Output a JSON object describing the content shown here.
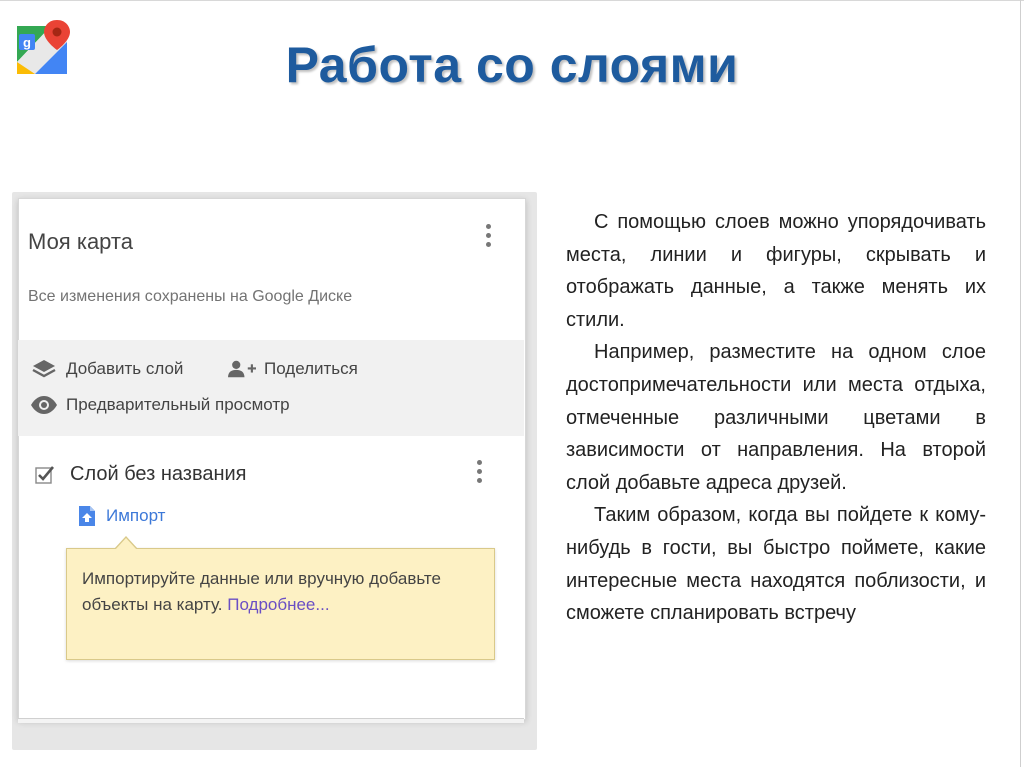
{
  "slide": {
    "title": "Работа со слоями"
  },
  "panel": {
    "map_title": "Моя карта",
    "saved_note": "Все изменения сохранены на Google Диске",
    "toolbar": {
      "add_layer": "Добавить слой",
      "share": "Поделиться",
      "preview": "Предварительный просмотр"
    },
    "layer": {
      "name": "Слой без названия",
      "checked": true,
      "import_label": "Импорт"
    },
    "tooltip": {
      "text": "Импортируйте данные или вручную добавьте объекты на карту.",
      "more_link": "Подробнее..."
    }
  },
  "body": {
    "paragraphs": [
      "С помощью слоев можно упорядочивать места, линии и фигуры, скрывать и отображать данные, а также менять их стили.",
      "Например, разместите на одном слое достопримечательности или места отдыха, отмеченные различными цветами в зависимости от направления. На второй слой добавьте адреса друзей.",
      "Таким образом, когда вы пойдете к кому-нибудь в гости, вы быстро поймете, какие интересные места находятся поблизости, и сможете спланировать встречу"
    ]
  },
  "icons": {
    "logo": "google-maps-logo-icon",
    "kebab": "more-vert-icon",
    "layers": "layers-icon",
    "share": "person-add-icon",
    "preview": "eye-icon",
    "checkbox": "checkbox-checked-icon",
    "import": "file-upload-icon"
  },
  "colors": {
    "title": "#1e5b9e",
    "link": "#3c78d8",
    "tooltip_bg": "#fdf1c4",
    "more_link": "#6a4fc4"
  }
}
